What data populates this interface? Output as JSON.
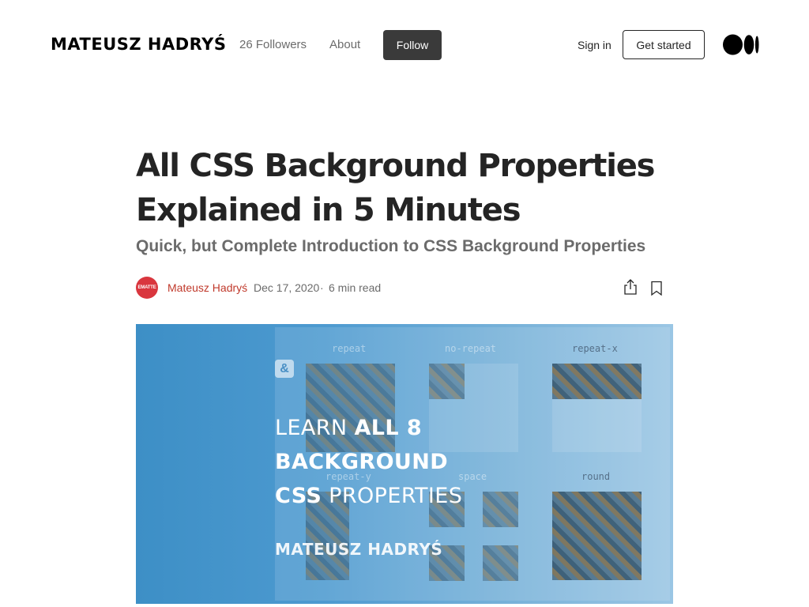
{
  "header": {
    "brand": "MATEUSZ HADRYŚ",
    "followers": "26 Followers",
    "about": "About",
    "follow_label": "Follow",
    "signin_label": "Sign in",
    "get_started_label": "Get started",
    "logo_icon": "medium-logo"
  },
  "article": {
    "title_line1": "All CSS Background Properties",
    "title_line2": "Explained in 5 Minutes",
    "subtitle": "Quick, but Complete Introduction to CSS Background Properties",
    "author_avatar_text": "EMATTE",
    "author": "Mateusz Hadryś",
    "date": "Dec 17, 2020",
    "separator": "·",
    "read_time": "6 min read",
    "share_icon": "share-icon",
    "bookmark_icon": "bookmark-icon"
  },
  "hero_image": {
    "labels": [
      "repeat",
      "no-repeat",
      "repeat-x",
      "repeat-y",
      "space",
      "round"
    ],
    "amp_symbol": "&",
    "headline_line1_light": "LEARN ",
    "headline_line1_bold": "ALL 8",
    "headline_line2_bold": "BACKGROUND",
    "headline_line3_bold": "CSS",
    "headline_line3_light": " PROPERTIES",
    "byline": "MATEUSZ HADRYŚ",
    "colors": {
      "gradient_start": "#3d8fc6",
      "gradient_end": "#9bc6e4"
    }
  },
  "colors": {
    "author_link": "#c0392b",
    "follow_button": "#3a3a3a",
    "avatar": "#d9363e"
  }
}
